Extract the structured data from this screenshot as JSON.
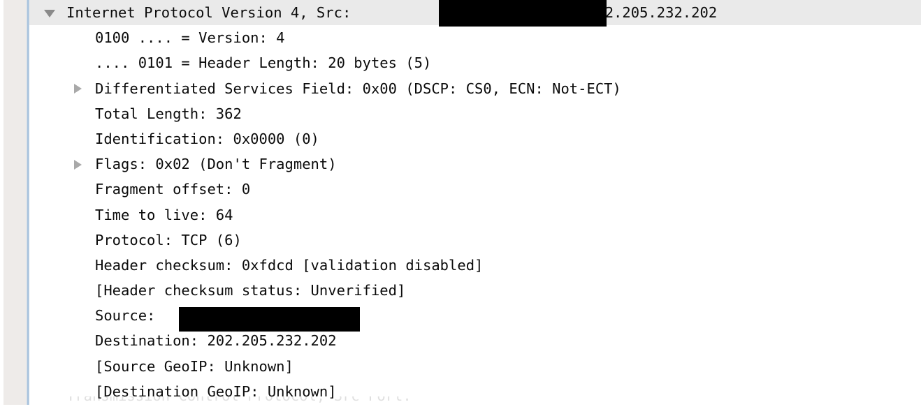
{
  "panel": {
    "name": "packet-details-tree",
    "gutter_clipped_text": "\n.\n.\n.\n.\n.\n.\n.\n.\n.\n.\n.\n.\n.\n.\n.",
    "colors": {
      "selection_background": "#eaeaea",
      "gutter_background": "#eeebe9",
      "gutter_divider": "#a9c3dd",
      "text": "#0b0b0b",
      "twisty_open": "#8a8a8a",
      "twisty_closed": "#a9a9a9",
      "redaction": "#000000",
      "panel_background": "#ffffff"
    }
  },
  "rows": [
    {
      "id": "ipv4-root",
      "depth": 0,
      "twisty": "expanded",
      "selected": true,
      "text_before": "Internet Protocol Version 4, Src: ",
      "text_after": ", Dst: 202.205.232.202",
      "redacted": true,
      "label": "Internet Protocol Version 4, Src: [redacted], Dst: 202.205.232.202"
    },
    {
      "id": "version",
      "depth": 1,
      "twisty": "none",
      "selected": false,
      "label": "0100 .... = Version: 4"
    },
    {
      "id": "header-length",
      "depth": 1,
      "twisty": "none",
      "selected": false,
      "label": ".... 0101 = Header Length: 20 bytes (5)"
    },
    {
      "id": "dsfield",
      "depth": 1,
      "twisty": "collapsed",
      "selected": false,
      "label": "Differentiated Services Field: 0x00 (DSCP: CS0, ECN: Not-ECT)"
    },
    {
      "id": "total-length",
      "depth": 1,
      "twisty": "none",
      "selected": false,
      "label": "Total Length: 362"
    },
    {
      "id": "identification",
      "depth": 1,
      "twisty": "none",
      "selected": false,
      "label": "Identification: 0x0000 (0)"
    },
    {
      "id": "flags",
      "depth": 1,
      "twisty": "collapsed",
      "selected": false,
      "label": "Flags: 0x02 (Don't Fragment)"
    },
    {
      "id": "fragment-offset",
      "depth": 1,
      "twisty": "none",
      "selected": false,
      "label": "Fragment offset: 0"
    },
    {
      "id": "time-to-live",
      "depth": 1,
      "twisty": "none",
      "selected": false,
      "label": "Time to live: 64"
    },
    {
      "id": "protocol",
      "depth": 1,
      "twisty": "none",
      "selected": false,
      "label": "Protocol: TCP (6)"
    },
    {
      "id": "header-checksum",
      "depth": 1,
      "twisty": "none",
      "selected": false,
      "label": "Header checksum: 0xfdcd [validation disabled]"
    },
    {
      "id": "header-checksum-status",
      "depth": 1,
      "twisty": "none",
      "selected": false,
      "label": "[Header checksum status: Unverified]"
    },
    {
      "id": "source",
      "depth": 1,
      "twisty": "none",
      "selected": false,
      "text_before": "Source: ",
      "redacted": true,
      "label": "Source: [redacted]"
    },
    {
      "id": "destination",
      "depth": 1,
      "twisty": "none",
      "selected": false,
      "label": "Destination: 202.205.232.202"
    },
    {
      "id": "source-geoip",
      "depth": 1,
      "twisty": "none",
      "selected": false,
      "label": "[Source GeoIP: Unknown]"
    },
    {
      "id": "destination-geoip",
      "depth": 1,
      "twisty": "none",
      "selected": false,
      "label": "[Destination GeoIP: Unknown]"
    }
  ],
  "partial_row": {
    "id": "next-row-clipped",
    "label": "Transmission Control Protocol, Src Port:"
  }
}
